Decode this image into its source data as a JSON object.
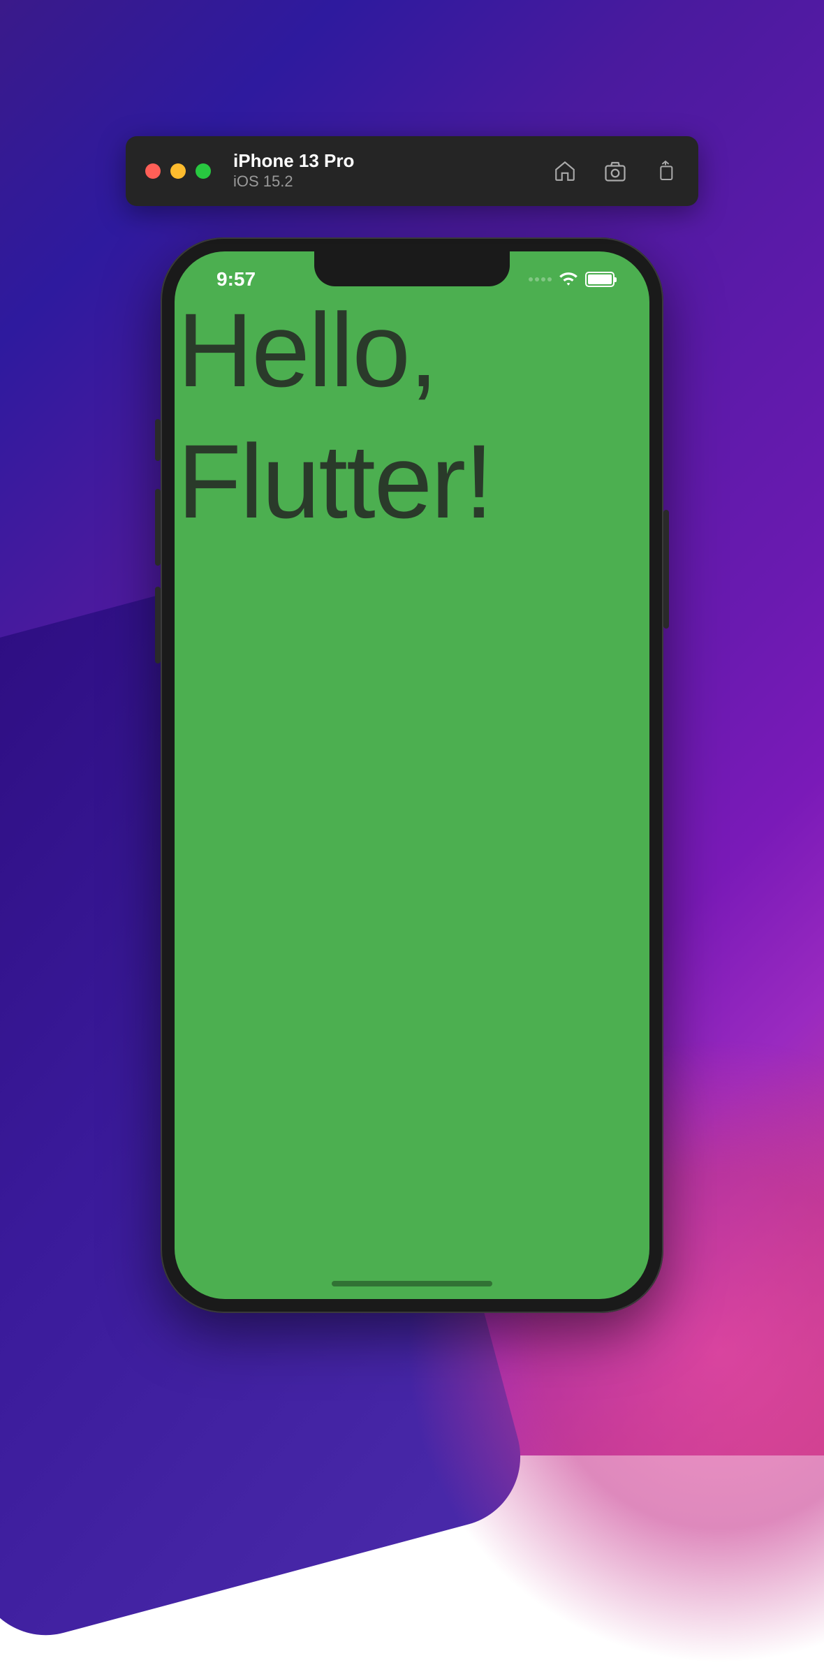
{
  "toolbar": {
    "device_name": "iPhone 13 Pro",
    "os_version": "iOS 15.2"
  },
  "status_bar": {
    "time": "9:57"
  },
  "app": {
    "greeting_text": "Hello, Flutter!",
    "background_color": "#4caf50"
  }
}
